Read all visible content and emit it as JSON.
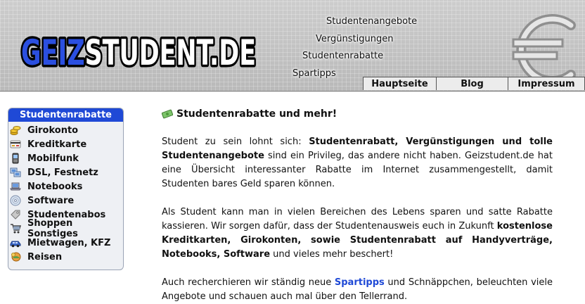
{
  "header": {
    "logo_text": "GEIZSTUDENT.DE",
    "links": [
      "Studentenangebote",
      "Vergünstigungen",
      "Studentenrabatte",
      "Spartipps"
    ],
    "tabs": [
      "Hauptseite",
      "Blog",
      "Impressum"
    ]
  },
  "sidebar": {
    "title": "Studentenrabatte",
    "items": [
      {
        "label": "Girokonto",
        "icon": "coins-icon"
      },
      {
        "label": "Kreditkarte",
        "icon": "credit-card-icon"
      },
      {
        "label": "Mobilfunk",
        "icon": "mobile-phone-icon"
      },
      {
        "label": "DSL, Festnetz",
        "icon": "network-icon"
      },
      {
        "label": "Notebooks",
        "icon": "notebook-icon"
      },
      {
        "label": "Software",
        "icon": "cd-icon"
      },
      {
        "label": "Studentenabos",
        "icon": "tag-icon"
      },
      {
        "label": "Shoppen Sonstiges",
        "icon": "shopping-cart-icon"
      },
      {
        "label": "Mietwagen, KFZ",
        "icon": "car-icon"
      },
      {
        "label": "Reisen",
        "icon": "travel-icon"
      }
    ]
  },
  "main": {
    "title": "Studentenrabatte und mehr!",
    "p1": {
      "a": "Student zu sein lohnt sich: ",
      "b": "Studentenrabatt, Vergünstigungen und tolle Studentenangebote",
      "c": " sind ein Privileg, das andere nicht haben. Geizstudent.de hat eine Übersicht interessanter Rabatte im Internet zusammengestellt, damit Studenten bares Geld sparen können."
    },
    "p2": {
      "a": "Als Student kann man in vielen Bereichen des Lebens sparen und satte Rabatte kassieren. Wir sorgen dafür, dass der Studentenausweis euch in Zukunft ",
      "b": "kostenlose Kreditkarten, Girokonten, sowie Studentenrabatt auf Handyverträge, Notebooks, Software",
      "c": " und vieles mehr beschert!"
    },
    "p3": {
      "a": "Auch recherchieren wir ständig neue ",
      "link": "Spartipps",
      "c": " und Schnäppchen, beleuchten viele Angebote und schauen auch mal über den Tellerrand."
    }
  },
  "colors": {
    "accent": "#1f49d6",
    "sidebar_bg": "#eef0f4",
    "header_bg": "#c4c4c4"
  }
}
